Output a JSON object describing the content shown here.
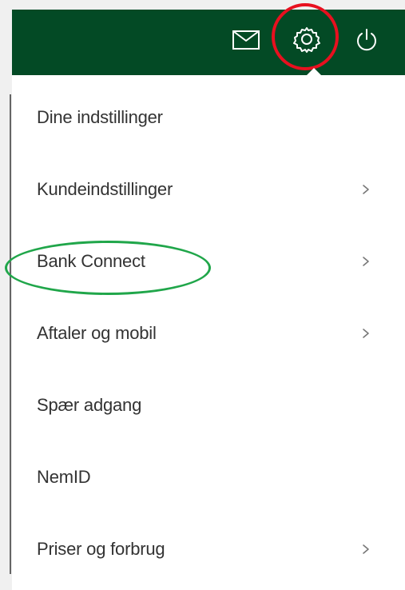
{
  "header": {
    "icons": [
      "mail-icon",
      "gear-icon",
      "power-icon"
    ],
    "background_color": "#034a25",
    "icon_color": "#ffffff",
    "highlight_color": "#e8101f"
  },
  "menu": {
    "items": [
      {
        "label": "Dine indstillinger",
        "has_chevron": false
      },
      {
        "label": "Kundeindstillinger",
        "has_chevron": true
      },
      {
        "label": "Bank Connect",
        "has_chevron": true,
        "highlighted": true
      },
      {
        "label": "Aftaler og mobil",
        "has_chevron": true
      },
      {
        "label": "Spær adgang",
        "has_chevron": false
      },
      {
        "label": "NemID",
        "has_chevron": false
      },
      {
        "label": "Priser og forbrug",
        "has_chevron": true
      }
    ],
    "text_color": "#333333",
    "highlight_color": "#20a64a"
  }
}
